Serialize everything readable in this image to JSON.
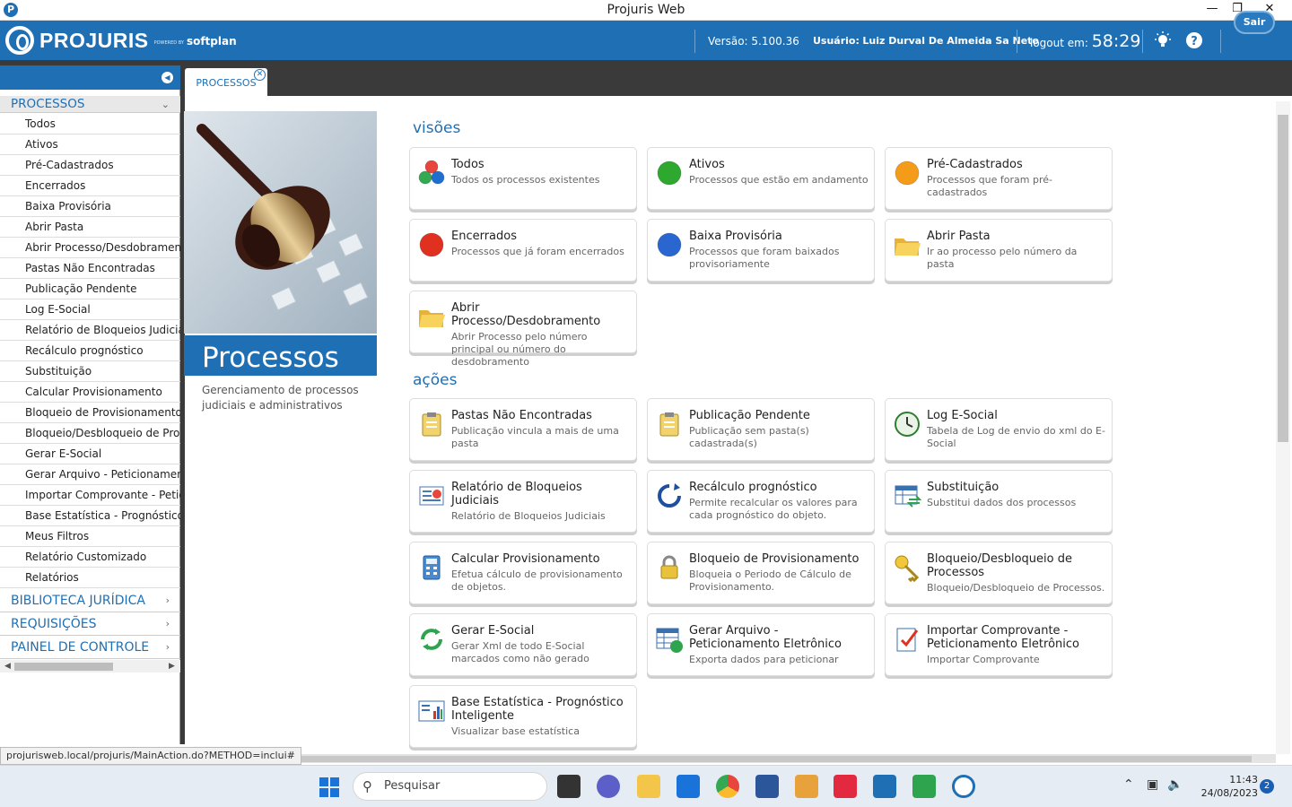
{
  "window": {
    "title": "Projuris Web"
  },
  "header": {
    "logo_text": "PROJURIS",
    "powered_by": "POWERED BY",
    "partner": "softplan",
    "version_label": "Versão:",
    "version": "5.100.36",
    "user_label": "Usuário:",
    "user": "Luiz Durval De Almeida Sa Neto",
    "logout_label": "logout em:",
    "logout_timer": "58:29",
    "sair_label": "Sair"
  },
  "tab": {
    "label": "PROCESSOS"
  },
  "sidebar": {
    "active_section": "PROCESSOS",
    "items": [
      "Todos",
      "Ativos",
      "Pré-Cadastrados",
      "Encerrados",
      "Baixa Provisória",
      "Abrir Pasta",
      "Abrir Processo/Desdobramento",
      "Pastas Não Encontradas",
      "Publicação Pendente",
      "Log E-Social",
      "Relatório de Bloqueios Judiciais",
      "Recálculo prognóstico",
      "Substituição",
      "Calcular Provisionamento",
      "Bloqueio de Provisionamento",
      "Bloqueio/Desbloqueio de Processos",
      "Gerar E-Social",
      "Gerar Arquivo - Peticionamento Eletrônico",
      "Importar Comprovante - Peticionamento Eletrônico",
      "Base Estatística - Prognóstico Inteligente",
      "Meus Filtros",
      "Relatório Customizado",
      "Relatórios"
    ],
    "sections": [
      "BIBLIOTECA JURÍDICA",
      "REQUISIÇÕES",
      "PAINEL DE CONTROLE"
    ]
  },
  "hero": {
    "title": "Processos",
    "description": "Gerenciamento de processos judiciais e administrativos"
  },
  "visoes": {
    "heading": "visões",
    "cards": [
      {
        "title": "Todos",
        "desc": "Todos os processos existentes",
        "icon": "multi-dots-icon"
      },
      {
        "title": "Ativos",
        "desc": "Processos que estão em andamento",
        "icon": "green-dot-icon"
      },
      {
        "title": "Pré-Cadastrados",
        "desc": "Processos que foram pré-cadastrados",
        "icon": "orange-dot-icon"
      },
      {
        "title": "Encerrados",
        "desc": "Processos que já foram encerrados",
        "icon": "red-dot-icon"
      },
      {
        "title": "Baixa Provisória",
        "desc": "Processos que foram baixados provisoriamente",
        "icon": "blue-dot-icon"
      },
      {
        "title": "Abrir Pasta",
        "desc": "Ir ao processo pelo número da pasta",
        "icon": "folder-open-icon"
      },
      {
        "title": "Abrir Processo/Desdobramento",
        "desc": "Abrir Processo pelo número principal ou número do desdobramento",
        "icon": "folder-open-icon"
      }
    ]
  },
  "acoes": {
    "heading": "ações",
    "cards": [
      {
        "title": "Pastas Não Encontradas",
        "desc": "Publicação vincula a mais de uma pasta",
        "icon": "clipboard-icon"
      },
      {
        "title": "Publicação Pendente",
        "desc": "Publicação sem pasta(s) cadastrada(s)",
        "icon": "clipboard-icon"
      },
      {
        "title": "Log E-Social",
        "desc": "Tabela de Log de envio do xml do E-Social",
        "icon": "clock-icon"
      },
      {
        "title": "Relatório de Bloqueios Judiciais",
        "desc": "Relatório de Bloqueios Judiciais",
        "icon": "report-icon"
      },
      {
        "title": "Recálculo prognóstico",
        "desc": "Permite recalcular os valores para cada prognóstico do objeto.",
        "icon": "refresh-icon"
      },
      {
        "title": "Substituição",
        "desc": "Substitui dados dos processos",
        "icon": "table-swap-icon"
      },
      {
        "title": "Calcular Provisionamento",
        "desc": "Efetua cálculo de provisionamento de objetos.",
        "icon": "calculator-icon"
      },
      {
        "title": "Bloqueio de Provisionamento",
        "desc": "Bloqueia o Periodo de Cálculo de Provisionamento.",
        "icon": "lock-icon"
      },
      {
        "title": "Bloqueio/Desbloqueio de Processos",
        "desc": "Bloqueio/Desbloqueio de Processos.",
        "icon": "key-icon"
      },
      {
        "title": "Gerar E-Social",
        "desc": "Gerar Xml de todo E-Social marcados como não gerado",
        "icon": "recycle-icon"
      },
      {
        "title": "Gerar Arquivo - Peticionamento Eletrônico",
        "desc": "Exporta dados para peticionar",
        "icon": "table-export-icon"
      },
      {
        "title": "Importar Comprovante - Peticionamento Eletrônico",
        "desc": "Importar Comprovante",
        "icon": "checklist-icon"
      },
      {
        "title": "Base Estatística - Prognóstico Inteligente",
        "desc": "Visualizar base estatística",
        "icon": "chart-icon"
      }
    ]
  },
  "status_url": "projurisweb.local/projuris/MainAction.do?METHOD=inclui#",
  "taskbar": {
    "search_placeholder": "Pesquisar",
    "time": "11:43",
    "date": "24/08/2023",
    "notifications": "2"
  }
}
